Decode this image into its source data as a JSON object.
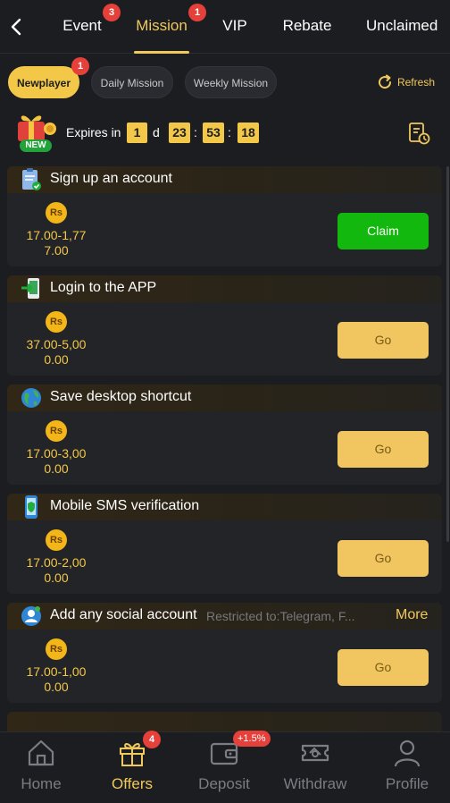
{
  "topnav": {
    "tabs": [
      {
        "label": "Event",
        "badge": "3"
      },
      {
        "label": "Mission",
        "badge": "1",
        "active": true
      },
      {
        "label": "VIP"
      },
      {
        "label": "Rebate"
      },
      {
        "label": "Unclaimed"
      }
    ]
  },
  "subtabs": [
    {
      "label": "Newplayer",
      "badge": "1",
      "active": true
    },
    {
      "label": "Daily Mission"
    },
    {
      "label": "Weekly Mission"
    }
  ],
  "refresh_label": "Refresh",
  "expiry": {
    "label": "Expires in",
    "days": "1",
    "day_unit": "d",
    "hours": "23",
    "minutes": "53",
    "seconds": "18",
    "sep": ":"
  },
  "gift_badge": "NEW",
  "missions": [
    {
      "title": "Sign up an account",
      "coin": "Rs",
      "reward_line1": "17.00-1,77",
      "reward_line2": "7.00",
      "button": "Claim"
    },
    {
      "title": "Login to the APP",
      "coin": "Rs",
      "reward_line1": "37.00-5,00",
      "reward_line2": "0.00",
      "button": "Go"
    },
    {
      "title": "Save desktop shortcut",
      "coin": "Rs",
      "reward_line1": "17.00-3,00",
      "reward_line2": "0.00",
      "button": "Go"
    },
    {
      "title": "Mobile SMS verification",
      "coin": "Rs",
      "reward_line1": "17.00-2,00",
      "reward_line2": "0.00",
      "button": "Go"
    },
    {
      "title": "Add any social account",
      "subtitle": "Restricted to:Telegram, F...",
      "more": "More",
      "coin": "Rs",
      "reward_line1": "17.00-1,00",
      "reward_line2": "0.00",
      "button": "Go"
    }
  ],
  "bottomnav": {
    "items": [
      {
        "label": "Home"
      },
      {
        "label": "Offers",
        "badge": "4",
        "active": true
      },
      {
        "label": "Deposit",
        "badge": "+1.5%"
      },
      {
        "label": "Withdraw"
      },
      {
        "label": "Profile"
      }
    ]
  },
  "colors": {
    "accent": "#f0c85c",
    "claim_green": "#12b80d",
    "badge_red": "#e5403a",
    "background": "#1c1d21"
  }
}
